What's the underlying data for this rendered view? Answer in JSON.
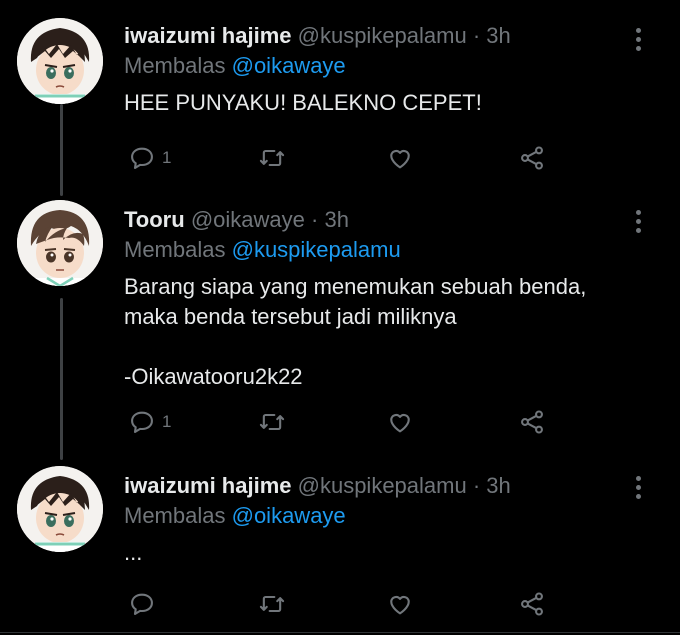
{
  "tweets": [
    {
      "name": "iwaizumi hajime",
      "handle": "@kuspikepalamu",
      "separator": "·",
      "time": "3h",
      "reply_prefix": "Membalas",
      "reply_to": "@oikawaye",
      "text": "HEE PUNYAKU! BALEKNO CEPET!",
      "reply_count": "1",
      "avatar_icon": "anime-avatar-iwaizumi"
    },
    {
      "name": "Tooru",
      "handle": "@oikawaye",
      "separator": "·",
      "time": "3h",
      "reply_prefix": "Membalas",
      "reply_to": "@kuspikepalamu",
      "text": "Barang siapa yang menemukan sebuah benda,\nmaka benda tersebut jadi miliknya\n\n-Oikawatooru2k22",
      "reply_count": "1",
      "avatar_icon": "anime-avatar-oikawa"
    },
    {
      "name": "iwaizumi hajime",
      "handle": "@kuspikepalamu",
      "separator": "·",
      "time": "3h",
      "reply_prefix": "Membalas",
      "reply_to": "@oikawaye",
      "text": "...",
      "reply_count": "",
      "avatar_icon": "anime-avatar-iwaizumi"
    }
  ],
  "colors": {
    "background": "#000000",
    "primary_text": "#e7e9ea",
    "secondary_text": "#71767b",
    "accent": "#1d9bf0",
    "thread_line": "#3e4144"
  },
  "icons": [
    "reply-icon",
    "retweet-icon",
    "like-icon",
    "share-icon",
    "more-options-icon"
  ]
}
